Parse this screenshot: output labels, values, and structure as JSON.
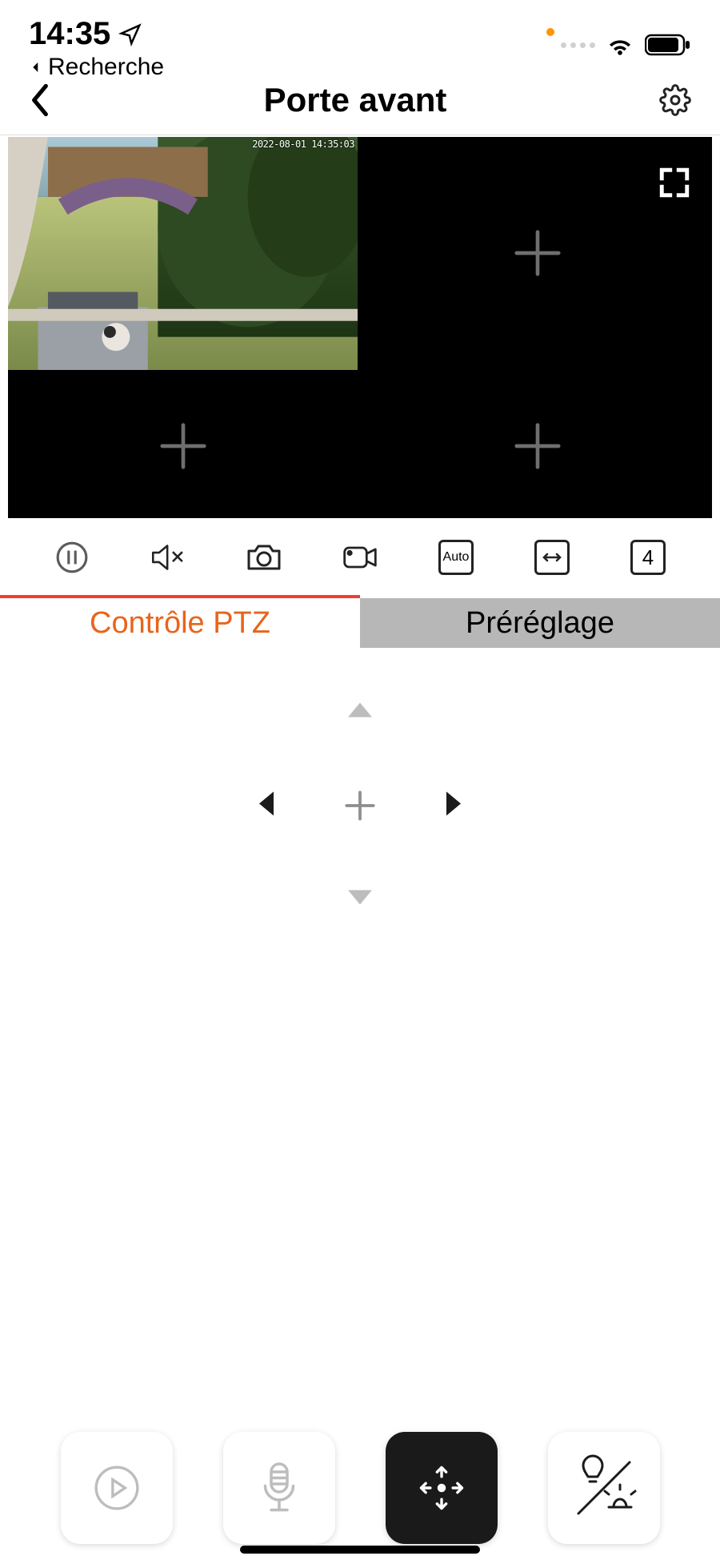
{
  "status": {
    "time": "14:35",
    "back_label": "Recherche"
  },
  "header": {
    "title": "Porte avant"
  },
  "video": {
    "timestamp_overlay": "2022-08-01 14:35:03"
  },
  "toolbar": {
    "auto_label": "Auto",
    "grid_label": "4"
  },
  "tabs": {
    "ptz": "Contrôle PTZ",
    "preset": "Préréglage"
  }
}
